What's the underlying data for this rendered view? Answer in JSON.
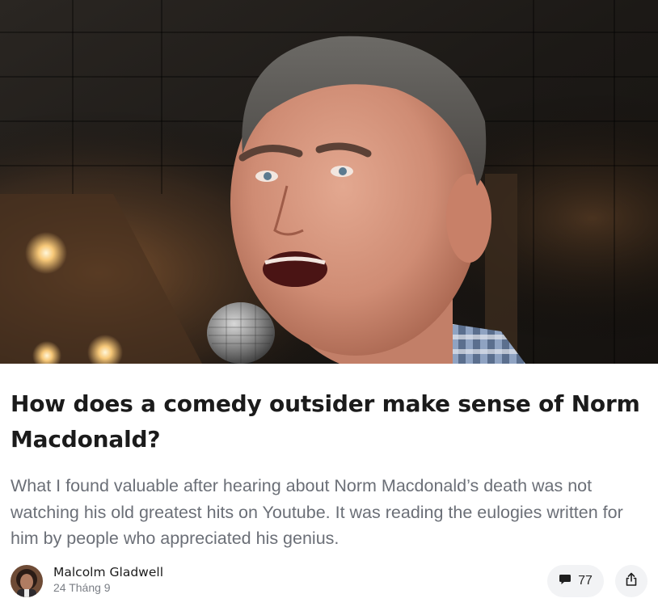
{
  "article": {
    "title": "How does a comedy outsider make sense of Norm Macdonald?",
    "subtitle": "What I found valuable after hearing about Norm Macdonald’s death was not watching his old greatest hits on Youtube. It was reading the eulogies written for him by people who appreciated his genius.",
    "hero_image": "comedian-at-microphone-photo"
  },
  "author": {
    "name": "Malcolm Gladwell",
    "date": "24 Tháng 9",
    "avatar": "author-avatar-photo"
  },
  "actions": {
    "comment_icon": "speech-bubble-icon",
    "comment_count": "77",
    "share_icon": "share-icon"
  }
}
